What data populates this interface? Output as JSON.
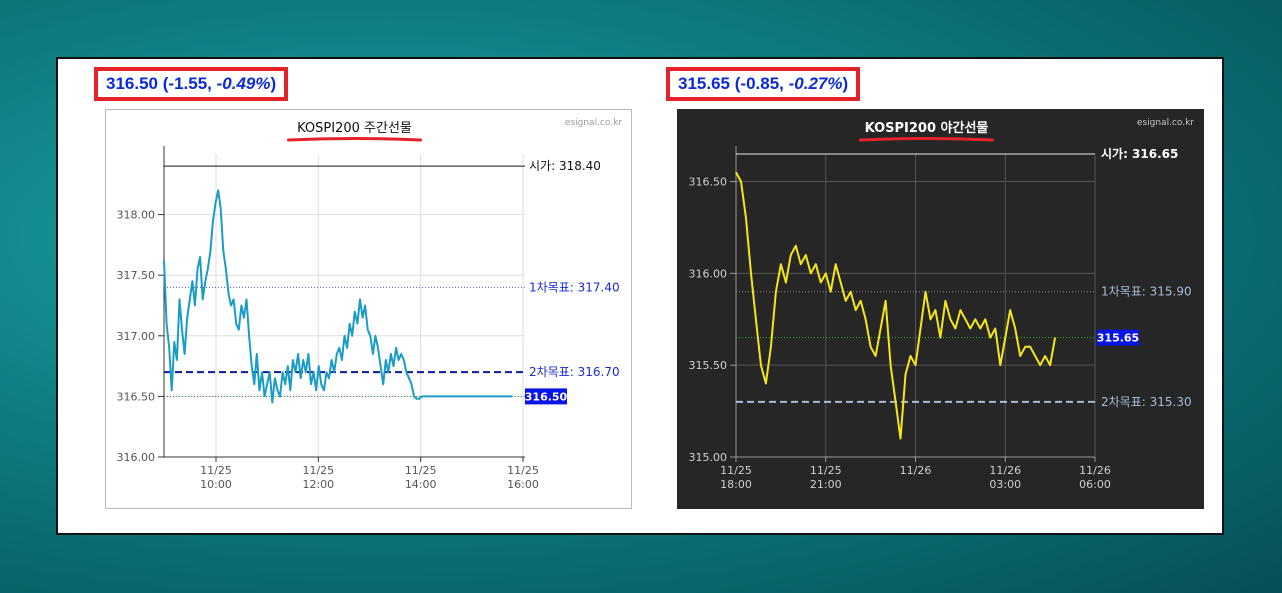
{
  "quotes": [
    {
      "price": "316.50",
      "change": "-1.55",
      "pct": "-0.49%"
    },
    {
      "price": "315.65",
      "change": "-0.85",
      "pct": "-0.27%"
    }
  ],
  "colors": {
    "accent_red": "#e4222a",
    "quote_blue": "#0a2ad6",
    "day_line": "#1a9cc8",
    "night_line": "#f5e61c",
    "night_bg": "#262626"
  },
  "chart_data": [
    {
      "type": "line",
      "title": "KOSPI200 주간선물",
      "watermark": "esignal.co.kr",
      "theme": "light",
      "x_ticks": [
        {
          "date": "11/25",
          "time": "10:00"
        },
        {
          "date": "11/25",
          "time": "12:00"
        },
        {
          "date": "11/25",
          "time": "14:00"
        },
        {
          "date": "11/25",
          "time": "16:00"
        }
      ],
      "xlim": [
        "09:00",
        "16:00"
      ],
      "y_ticks": [
        "316.00",
        "316.50",
        "317.00",
        "317.50",
        "318.00"
      ],
      "ylim": [
        316.0,
        318.5
      ],
      "series": [
        {
          "color": "#1a9cc8",
          "x": [
            "09:00",
            "09:03",
            "09:06",
            "09:09",
            "09:12",
            "09:15",
            "09:18",
            "09:21",
            "09:24",
            "09:27",
            "09:30",
            "09:33",
            "09:36",
            "09:39",
            "09:42",
            "09:45",
            "09:48",
            "09:51",
            "09:54",
            "09:57",
            "10:00",
            "10:03",
            "10:06",
            "10:09",
            "10:12",
            "10:15",
            "10:18",
            "10:21",
            "10:24",
            "10:27",
            "10:30",
            "10:33",
            "10:36",
            "10:39",
            "10:42",
            "10:45",
            "10:48",
            "10:51",
            "10:54",
            "10:57",
            "11:00",
            "11:03",
            "11:06",
            "11:09",
            "11:12",
            "11:15",
            "11:18",
            "11:21",
            "11:24",
            "11:27",
            "11:30",
            "11:33",
            "11:36",
            "11:39",
            "11:42",
            "11:45",
            "11:48",
            "11:51",
            "11:54",
            "11:57",
            "12:00",
            "12:03",
            "12:06",
            "12:09",
            "12:12",
            "12:15",
            "12:18",
            "12:21",
            "12:24",
            "12:27",
            "12:30",
            "12:33",
            "12:36",
            "12:39",
            "12:42",
            "12:45",
            "12:48",
            "12:51",
            "12:54",
            "12:57",
            "13:00",
            "13:03",
            "13:06",
            "13:09",
            "13:12",
            "13:15",
            "13:18",
            "13:21",
            "13:24",
            "13:27",
            "13:30",
            "13:33",
            "13:36",
            "13:39",
            "13:42",
            "13:45",
            "13:48",
            "13:51",
            "13:54",
            "13:57",
            "14:00",
            "14:03",
            "14:06",
            "14:09",
            "14:12",
            "14:15",
            "14:18",
            "14:21",
            "14:24",
            "14:27",
            "14:30",
            "14:33",
            "14:36",
            "14:39",
            "14:42",
            "14:45",
            "14:48",
            "14:51",
            "14:54",
            "14:57",
            "15:00",
            "15:03",
            "15:06",
            "15:09",
            "15:12",
            "15:15",
            "15:18",
            "15:21",
            "15:24",
            "15:27",
            "15:30",
            "15:33",
            "15:36",
            "15:39",
            "15:42",
            "15:45"
          ],
          "values": [
            317.62,
            317.1,
            316.9,
            316.55,
            316.95,
            316.8,
            317.3,
            317.05,
            316.85,
            317.15,
            317.3,
            317.45,
            317.25,
            317.55,
            317.65,
            317.3,
            317.45,
            317.55,
            317.7,
            317.95,
            318.1,
            318.2,
            318.05,
            317.7,
            317.55,
            317.35,
            317.25,
            317.3,
            317.1,
            317.05,
            317.25,
            317.15,
            317.3,
            317.0,
            316.75,
            316.6,
            316.85,
            316.55,
            316.7,
            316.5,
            316.6,
            316.7,
            316.45,
            316.65,
            316.55,
            316.5,
            316.7,
            316.6,
            316.75,
            316.55,
            316.8,
            316.7,
            316.85,
            316.65,
            316.8,
            316.7,
            316.85,
            316.6,
            316.7,
            316.55,
            316.75,
            316.6,
            316.55,
            316.7,
            316.65,
            316.8,
            316.7,
            316.85,
            316.9,
            316.8,
            317.0,
            316.9,
            317.1,
            317.0,
            317.2,
            317.1,
            317.3,
            317.15,
            317.25,
            317.05,
            317.0,
            316.85,
            317.0,
            316.9,
            316.75,
            316.6,
            316.8,
            316.7,
            316.85,
            316.75,
            316.9,
            316.8,
            316.85,
            316.8,
            316.7,
            316.65,
            316.6,
            316.5,
            316.48,
            316.48,
            316.5,
            316.5,
            316.5,
            316.5,
            316.5,
            316.5,
            316.5,
            316.5,
            316.5,
            316.5,
            316.5,
            316.5,
            316.5,
            316.5,
            316.5,
            316.5,
            316.5,
            316.5,
            316.5,
            316.5,
            316.5,
            316.5,
            316.5,
            316.5,
            316.5,
            316.5,
            316.5,
            316.5,
            316.5,
            316.5,
            316.5,
            316.5,
            316.5,
            316.5,
            316.5,
            316.5
          ]
        }
      ],
      "reference_lines": [
        {
          "label": "시가",
          "value": 318.4,
          "display": "318.40",
          "style": "solid",
          "color": "#111111",
          "label_color": "#111111"
        },
        {
          "label": "1차목표",
          "value": 317.4,
          "display": "317.40",
          "style": "dotted",
          "color": "#4a56a6",
          "label_color": "#1a2ad6"
        },
        {
          "label": "2차목표",
          "value": 316.7,
          "display": "316.70",
          "style": "dashed",
          "color": "#0a1a9a",
          "label_color": "#1a2ad6"
        },
        {
          "label": "",
          "value": 316.5,
          "display": "",
          "style": "dotted",
          "color": "#2a8a2a",
          "label_color": ""
        }
      ],
      "last_price": {
        "value": 316.5,
        "display": "316.50",
        "bg": "#0a14e6"
      }
    },
    {
      "type": "line",
      "title": "KOSPI200 야간선물",
      "watermark": "esignal.co.kr",
      "theme": "dark",
      "x_ticks": [
        {
          "date": "11/25",
          "time": "18:00"
        },
        {
          "date": "11/25",
          "time": "21:00"
        },
        {
          "date": "11/26",
          "time": ""
        },
        {
          "date": "11/26",
          "time": "03:00"
        },
        {
          "date": "11/26",
          "time": "06:00"
        }
      ],
      "xlim": [
        "11/25 18:00",
        "11/26 06:00"
      ],
      "y_ticks": [
        "315.00",
        "315.50",
        "316.00",
        "316.50"
      ],
      "ylim": [
        315.0,
        316.65
      ],
      "series": [
        {
          "color": "#f5e61c",
          "x": [
            "11/25 18:00",
            "11/25 18:10",
            "11/25 18:20",
            "11/25 18:30",
            "11/25 18:40",
            "11/25 18:50",
            "11/25 19:00",
            "11/25 19:10",
            "11/25 19:20",
            "11/25 19:30",
            "11/25 19:40",
            "11/25 19:50",
            "11/25 20:00",
            "11/25 20:10",
            "11/25 20:20",
            "11/25 20:30",
            "11/25 20:40",
            "11/25 20:50",
            "11/25 21:00",
            "11/25 21:10",
            "11/25 21:20",
            "11/25 21:30",
            "11/25 21:40",
            "11/25 21:50",
            "11/25 22:00",
            "11/25 22:10",
            "11/25 22:20",
            "11/25 22:30",
            "11/25 22:40",
            "11/25 22:50",
            "11/25 23:00",
            "11/25 23:10",
            "11/25 23:20",
            "11/25 23:30",
            "11/25 23:40",
            "11/25 23:50",
            "11/26 00:00",
            "11/26 00:10",
            "11/26 00:20",
            "11/26 00:30",
            "11/26 00:40",
            "11/26 00:50",
            "11/26 01:00",
            "11/26 01:10",
            "11/26 01:20",
            "11/26 01:30",
            "11/26 01:40",
            "11/26 01:50",
            "11/26 02:00",
            "11/26 02:10",
            "11/26 02:20",
            "11/26 02:30",
            "11/26 02:40",
            "11/26 02:50",
            "11/26 03:00",
            "11/26 03:10",
            "11/26 03:20",
            "11/26 03:30",
            "11/26 03:40",
            "11/26 03:50",
            "11/26 04:00",
            "11/26 04:10",
            "11/26 04:20",
            "11/26 04:30",
            "11/26 04:40"
          ],
          "values": [
            316.55,
            316.5,
            316.3,
            316.0,
            315.75,
            315.5,
            315.4,
            315.6,
            315.9,
            316.05,
            315.95,
            316.1,
            316.15,
            316.05,
            316.1,
            316.0,
            316.05,
            315.95,
            316.0,
            315.9,
            316.05,
            315.95,
            315.85,
            315.9,
            315.8,
            315.85,
            315.75,
            315.6,
            315.55,
            315.7,
            315.85,
            315.5,
            315.3,
            315.1,
            315.45,
            315.55,
            315.5,
            315.7,
            315.9,
            315.75,
            315.8,
            315.65,
            315.85,
            315.75,
            315.7,
            315.8,
            315.75,
            315.7,
            315.75,
            315.7,
            315.75,
            315.65,
            315.7,
            315.5,
            315.65,
            315.8,
            315.7,
            315.55,
            315.6,
            315.6,
            315.55,
            315.5,
            315.55,
            315.5,
            315.65
          ]
        }
      ],
      "reference_lines": [
        {
          "label": "시가",
          "value": 316.65,
          "display": "316.65",
          "style": "solid",
          "color": "#e8e8e8",
          "label_color": "#ffffff"
        },
        {
          "label": "1차목표",
          "value": 315.9,
          "display": "315.90",
          "style": "dotted",
          "color": "#8a8a8a",
          "label_color": "#a8bcd8"
        },
        {
          "label": "",
          "value": 315.65,
          "display": "",
          "style": "dotted",
          "color": "#2eb82e",
          "label_color": ""
        },
        {
          "label": "2차목표",
          "value": 315.3,
          "display": "315.30",
          "style": "dashed",
          "color": "#a8bcd8",
          "label_color": "#a8bcd8"
        }
      ],
      "last_price": {
        "value": 315.65,
        "display": "315.65",
        "bg": "#0a14e6"
      }
    }
  ]
}
